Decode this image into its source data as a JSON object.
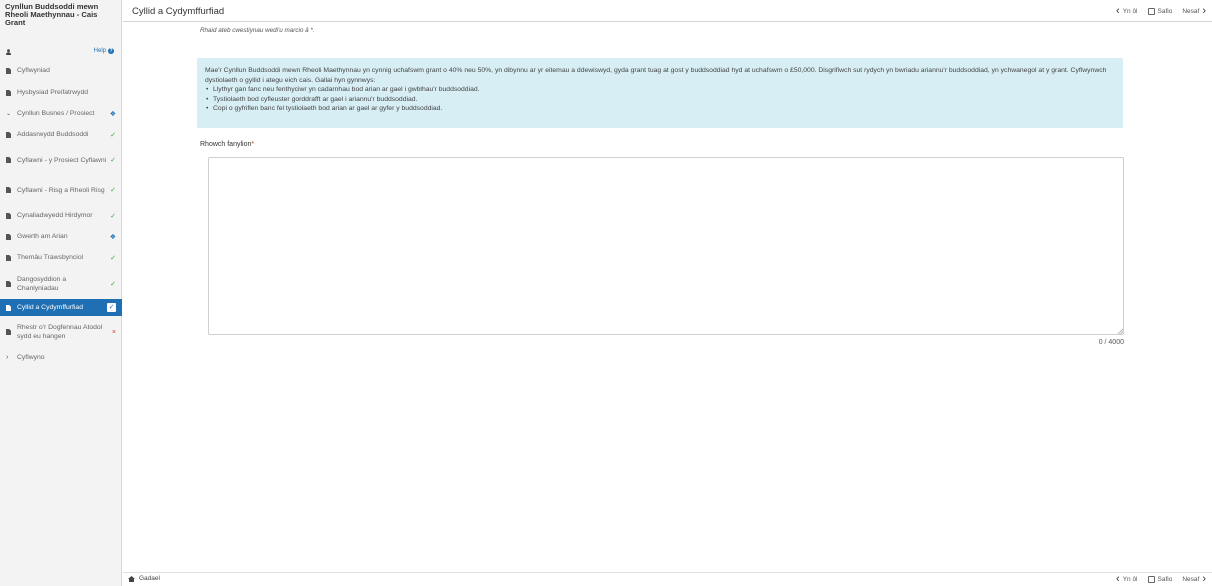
{
  "app": {
    "title": "Cynllun Buddsoddi mewn Rheoli Maethynnau - Cais Grant",
    "help_label": "Help"
  },
  "sidebar": {
    "items": [
      {
        "label": "Cyflwyniad",
        "status": "none"
      },
      {
        "label": "Hysbysiad Preifatrwydd",
        "status": "none"
      },
      {
        "label": "Cynllun Busnes / Prosiect",
        "status": "info",
        "expanded": true
      },
      {
        "label": "Addasrwydd Buddsoddi",
        "status": "check"
      },
      {
        "label": "Cyflawni - y Prosiect Cyflawni",
        "status": "check"
      },
      {
        "label": "Cyflawni - Risg a Rheoli Risg",
        "status": "check"
      },
      {
        "label": "Cynaliadwyedd Hirdymor",
        "status": "check"
      },
      {
        "label": "Gwerth am Arian",
        "status": "info"
      },
      {
        "label": "Themâu Trawsbynciol",
        "status": "check"
      },
      {
        "label": "Dangosyddion a Chanlyniadau",
        "status": "check"
      },
      {
        "label": "Cyllid a Cydymffurfiad",
        "status": "active"
      },
      {
        "label": "Rhestr o'r Dogfennau Atodol sydd eu hangen",
        "status": "cross"
      },
      {
        "label": "Cyflwyno",
        "status": "collapsed"
      }
    ]
  },
  "header": {
    "page_title": "Cyllid a Cydymffurfiad"
  },
  "toolbar": {
    "back_label": "Yn ôl",
    "save_label": "Safio",
    "next_label": "Nesaf"
  },
  "main": {
    "required_note": "Rhaid ateb cwestiynau wedi'u marcio â *.",
    "info_paragraph": "Mae'r Cynllun Buddsoddi mewn Rheoli Maethynnau yn cynnig uchafswm grant o 40% neu 50%, yn dibynnu ar yr eitemau a ddewiswyd, gyda grant tuag at gost y buddsoddiad hyd at uchafswm o £50,000. Disgrifiwch sut rydych yn bwriadu ariannu'r buddsoddiad, yn ychwanegol at y grant. Cyflwynwch dystiolaeth o gyllid i ategu eich cais. Gallai hyn gynnwys:",
    "info_bullets": [
      "Llythyr gan fanc neu fenthyciwr yn cadarnhau bod arian ar gael i gwblhau'r buddsoddiad.",
      "Tystiolaeth bod cyfleuster gorddrafft ar gael i ariannu'r buddsoddiad.",
      "Copi o gyfriflen banc fel tystiolaeth bod arian ar gael ar gyfer y buddsoddiad."
    ],
    "details_label": "Rhowch fanylion",
    "required_marker": "*",
    "details_value": "",
    "char_count": "0 / 4000"
  },
  "footer": {
    "save_exit_label": "Gadael"
  }
}
